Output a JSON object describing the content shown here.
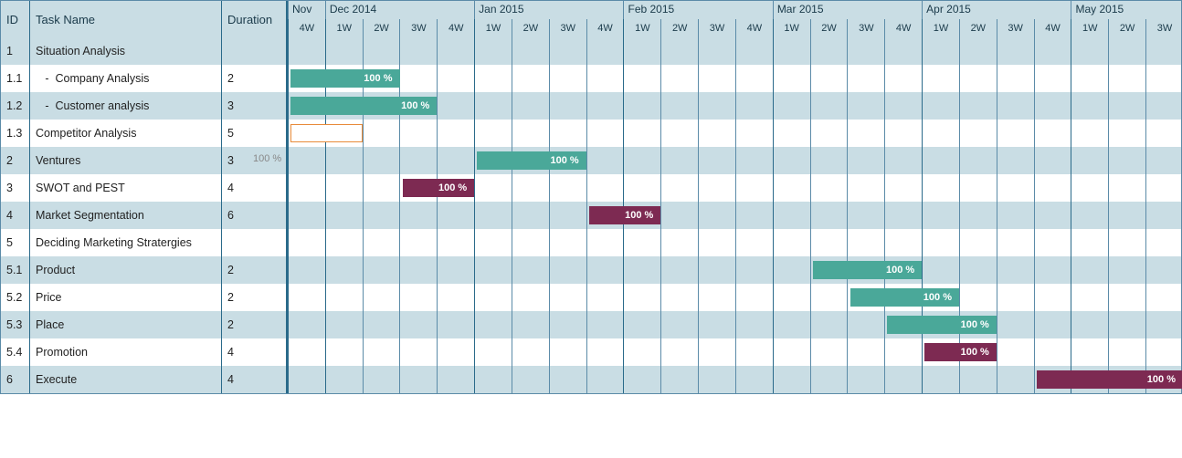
{
  "headers": {
    "id": "ID",
    "name": "Task Name",
    "dur": "Duration"
  },
  "months": [
    {
      "label": "Nov",
      "weeks": [
        "4W"
      ]
    },
    {
      "label": "Dec 2014",
      "weeks": [
        "1W",
        "2W",
        "3W",
        "4W"
      ]
    },
    {
      "label": "Jan 2015",
      "weeks": [
        "1W",
        "2W",
        "3W",
        "4W"
      ]
    },
    {
      "label": "Feb 2015",
      "weeks": [
        "1W",
        "2W",
        "3W",
        "4W"
      ]
    },
    {
      "label": "Mar 2015",
      "weeks": [
        "1W",
        "2W",
        "3W",
        "4W"
      ]
    },
    {
      "label": "Apr 2015",
      "weeks": [
        "1W",
        "2W",
        "3W",
        "4W"
      ]
    },
    {
      "label": "May 2015",
      "weeks": [
        "1W",
        "2W",
        "3W"
      ]
    }
  ],
  "rows": [
    {
      "id": "1",
      "name": "Situation Analysis",
      "dur": "",
      "bar": null
    },
    {
      "id": "1.1",
      "name": "   -  Company Analysis",
      "dur": "2",
      "bar": {
        "start": 0,
        "span": 3,
        "style": "teal",
        "label": "100 %"
      }
    },
    {
      "id": "1.2",
      "name": "   -  Customer analysis",
      "dur": "3",
      "bar": {
        "start": 0,
        "span": 4,
        "style": "teal",
        "label": "100 %"
      }
    },
    {
      "id": "1.3",
      "name": "Competitor Analysis",
      "dur": "5",
      "bar": {
        "start": 0,
        "span": 2,
        "style": "outline",
        "label": ""
      }
    },
    {
      "id": "2",
      "name": "Ventures",
      "dur": "3",
      "bar": {
        "start": 5,
        "span": 3,
        "style": "teal",
        "label": "100 %"
      },
      "ext_label": "100 %"
    },
    {
      "id": "3",
      "name": "SWOT and PEST",
      "dur": "4",
      "bar": {
        "start": 3,
        "span": 2,
        "style": "purple",
        "label": "100 %"
      }
    },
    {
      "id": "4",
      "name": "Market Segmentation",
      "dur": "6",
      "bar": {
        "start": 8,
        "span": 2,
        "style": "purple",
        "label": "100 %"
      }
    },
    {
      "id": "5",
      "name": "Deciding Marketing Stratergies",
      "dur": "",
      "bar": null
    },
    {
      "id": "5.1",
      "name": "Product",
      "dur": "2",
      "bar": {
        "start": 14,
        "span": 3,
        "style": "teal",
        "label": "100 %"
      }
    },
    {
      "id": "5.2",
      "name": "Price",
      "dur": "2",
      "bar": {
        "start": 15,
        "span": 3,
        "style": "teal",
        "label": "100 %"
      }
    },
    {
      "id": "5.3",
      "name": "Place",
      "dur": "2",
      "bar": {
        "start": 16,
        "span": 3,
        "style": "teal",
        "label": "100 %"
      }
    },
    {
      "id": "5.4",
      "name": "Promotion",
      "dur": "4",
      "bar": {
        "start": 17,
        "span": 2,
        "style": "purple",
        "label": "100 %"
      }
    },
    {
      "id": "6",
      "name": "Execute",
      "dur": "4",
      "bar": {
        "start": 20,
        "span": 4,
        "style": "purple",
        "label": "100 %"
      }
    }
  ],
  "chart_data": {
    "type": "gantt",
    "title": "",
    "time_unit": "week",
    "timeline_start": "2014-11-W4",
    "timeline_end": "2015-05-W3",
    "week_labels": [
      "Nov 4W",
      "Dec 1W",
      "Dec 2W",
      "Dec 3W",
      "Dec 4W",
      "Jan 1W",
      "Jan 2W",
      "Jan 3W",
      "Jan 4W",
      "Feb 1W",
      "Feb 2W",
      "Feb 3W",
      "Feb 4W",
      "Mar 1W",
      "Mar 2W",
      "Mar 3W",
      "Mar 4W",
      "Apr 1W",
      "Apr 2W",
      "Apr 3W",
      "Apr 4W",
      "May 1W",
      "May 2W",
      "May 3W"
    ],
    "series": [
      {
        "id": "1",
        "name": "Situation Analysis",
        "duration_weeks": null,
        "start_week_index": null,
        "span_weeks": null,
        "percent_complete": null,
        "color": null,
        "is_group": true
      },
      {
        "id": "1.1",
        "name": "Company Analysis",
        "duration_weeks": 2,
        "start_week_index": 0,
        "span_weeks": 3,
        "percent_complete": 100,
        "color": "teal",
        "is_group": false
      },
      {
        "id": "1.2",
        "name": "Customer analysis",
        "duration_weeks": 3,
        "start_week_index": 0,
        "span_weeks": 4,
        "percent_complete": 100,
        "color": "teal",
        "is_group": false
      },
      {
        "id": "1.3",
        "name": "Competitor Analysis",
        "duration_weeks": 5,
        "start_week_index": 0,
        "span_weeks": 2,
        "percent_complete": 0,
        "color": "outline",
        "is_group": false
      },
      {
        "id": "2",
        "name": "Ventures",
        "duration_weeks": 3,
        "start_week_index": 5,
        "span_weeks": 3,
        "percent_complete": 100,
        "color": "teal",
        "is_group": false
      },
      {
        "id": "3",
        "name": "SWOT and PEST",
        "duration_weeks": 4,
        "start_week_index": 3,
        "span_weeks": 2,
        "percent_complete": 100,
        "color": "purple",
        "is_group": false
      },
      {
        "id": "4",
        "name": "Market Segmentation",
        "duration_weeks": 6,
        "start_week_index": 8,
        "span_weeks": 2,
        "percent_complete": 100,
        "color": "purple",
        "is_group": false
      },
      {
        "id": "5",
        "name": "Deciding Marketing Stratergies",
        "duration_weeks": null,
        "start_week_index": null,
        "span_weeks": null,
        "percent_complete": null,
        "color": null,
        "is_group": true
      },
      {
        "id": "5.1",
        "name": "Product",
        "duration_weeks": 2,
        "start_week_index": 14,
        "span_weeks": 3,
        "percent_complete": 100,
        "color": "teal",
        "is_group": false
      },
      {
        "id": "5.2",
        "name": "Price",
        "duration_weeks": 2,
        "start_week_index": 15,
        "span_weeks": 3,
        "percent_complete": 100,
        "color": "teal",
        "is_group": false
      },
      {
        "id": "5.3",
        "name": "Place",
        "duration_weeks": 2,
        "start_week_index": 16,
        "span_weeks": 3,
        "percent_complete": 100,
        "color": "teal",
        "is_group": false
      },
      {
        "id": "5.4",
        "name": "Promotion",
        "duration_weeks": 4,
        "start_week_index": 17,
        "span_weeks": 2,
        "percent_complete": 100,
        "color": "purple",
        "is_group": false
      },
      {
        "id": "6",
        "name": "Execute",
        "duration_weeks": 4,
        "start_week_index": 20,
        "span_weeks": 4,
        "percent_complete": 100,
        "color": "purple",
        "is_group": false
      }
    ],
    "colors": {
      "teal": "#4aa899",
      "purple": "#7d2a52",
      "outline_border": "#e88b3a",
      "header_bg": "#c9dde4",
      "grid_line": "#5b8ba8"
    }
  }
}
